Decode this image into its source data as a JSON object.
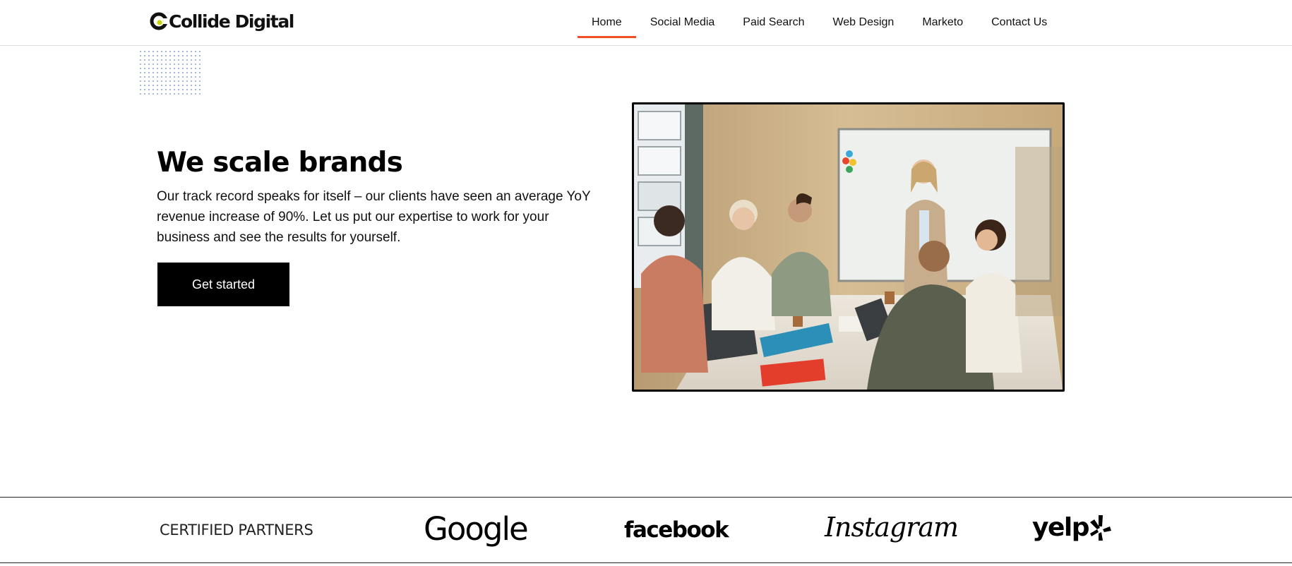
{
  "brand": {
    "name": "Collide Digital",
    "accent_color": "#f04e23",
    "logo_icon": "collide-logo-icon"
  },
  "nav": {
    "items": [
      {
        "label": "Home",
        "active": true
      },
      {
        "label": "Social Media",
        "active": false
      },
      {
        "label": "Paid Search",
        "active": false
      },
      {
        "label": "Web Design",
        "active": false
      },
      {
        "label": "Marketo",
        "active": false
      },
      {
        "label": "Contact Us",
        "active": false
      }
    ]
  },
  "hero": {
    "title": "We scale brands",
    "description": "Our track record speaks for itself – our clients have seen an average YoY revenue increase of 90%. Let us put our expertise to work for your business and see the results for yourself.",
    "cta_label": "Get started",
    "cta_bg": "#000000",
    "image_icon": "team-meeting-photo"
  },
  "partners": {
    "label": "CERTIFIED PARTNERS",
    "logos": [
      "Google",
      "facebook",
      "Instagram",
      "yelp"
    ]
  }
}
